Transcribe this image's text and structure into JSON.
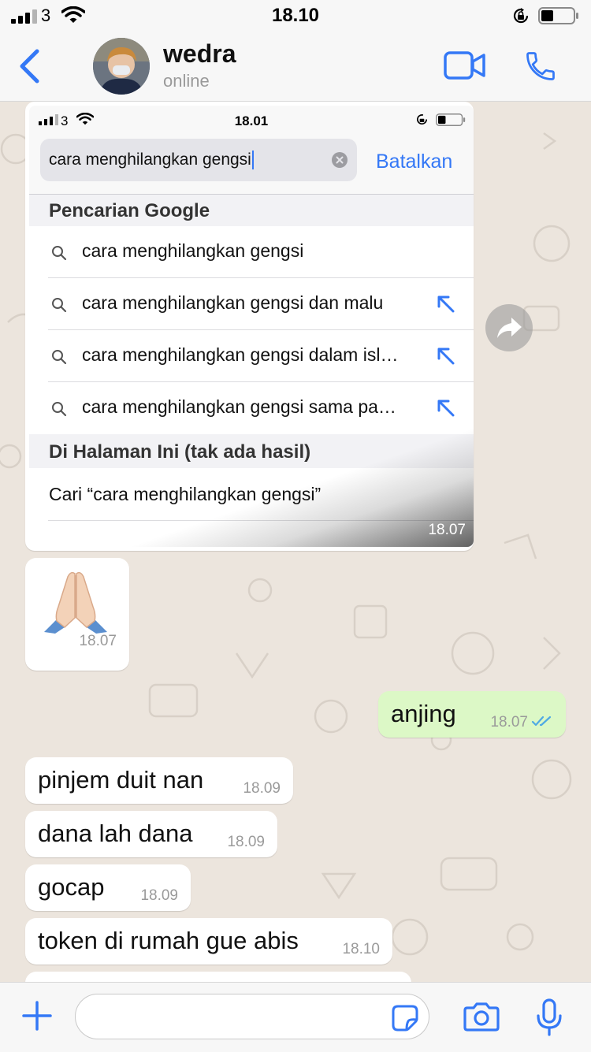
{
  "status_bar": {
    "carrier": "3",
    "time": "18.10"
  },
  "header": {
    "contact_name": "wedra",
    "contact_status": "online",
    "icons": [
      "back-chevron-icon",
      "video-call-icon",
      "phone-icon"
    ]
  },
  "screenshot": {
    "carrier": "3",
    "time": "18.01",
    "search_query": "cara menghilangkan gengsi",
    "cancel_label": "Batalkan",
    "section_google": "Pencarian Google",
    "suggestions": [
      "cara menghilangkan gengsi",
      "cara menghilangkan gengsi dan malu",
      "cara menghilangkan gengsi dalam isl…",
      "cara menghilangkan gengsi sama pa…"
    ],
    "section_page": "Di Halaman Ini (tak ada hasil)",
    "find_text": "Cari “cara menghilangkan gengsi”",
    "sent_time": "18.07"
  },
  "emoji_message": {
    "emoji_name": "folded-hands",
    "time": "18.07"
  },
  "messages": [
    {
      "direction": "outgoing",
      "text": "anjing",
      "time": "18.07",
      "status": "read"
    },
    {
      "direction": "incoming",
      "text": "pinjem duit nan",
      "time": "18.09"
    },
    {
      "direction": "incoming",
      "text": "dana lah dana",
      "time": "18.09"
    },
    {
      "direction": "incoming",
      "text": "gocap",
      "time": "18.09"
    },
    {
      "direction": "incoming",
      "text": "token di rumah gue abis",
      "time": "18.10"
    }
  ],
  "input_bar": {
    "message_value": "",
    "icons": [
      "plus-icon",
      "sticker-icon",
      "camera-icon",
      "microphone-icon"
    ]
  },
  "colors": {
    "accent": "#3478f6",
    "chat_background": "#ece5dd",
    "outgoing_bubble": "#dcf8c6",
    "incoming_bubble": "#ffffff",
    "read_ticks": "#4fa9e3"
  }
}
